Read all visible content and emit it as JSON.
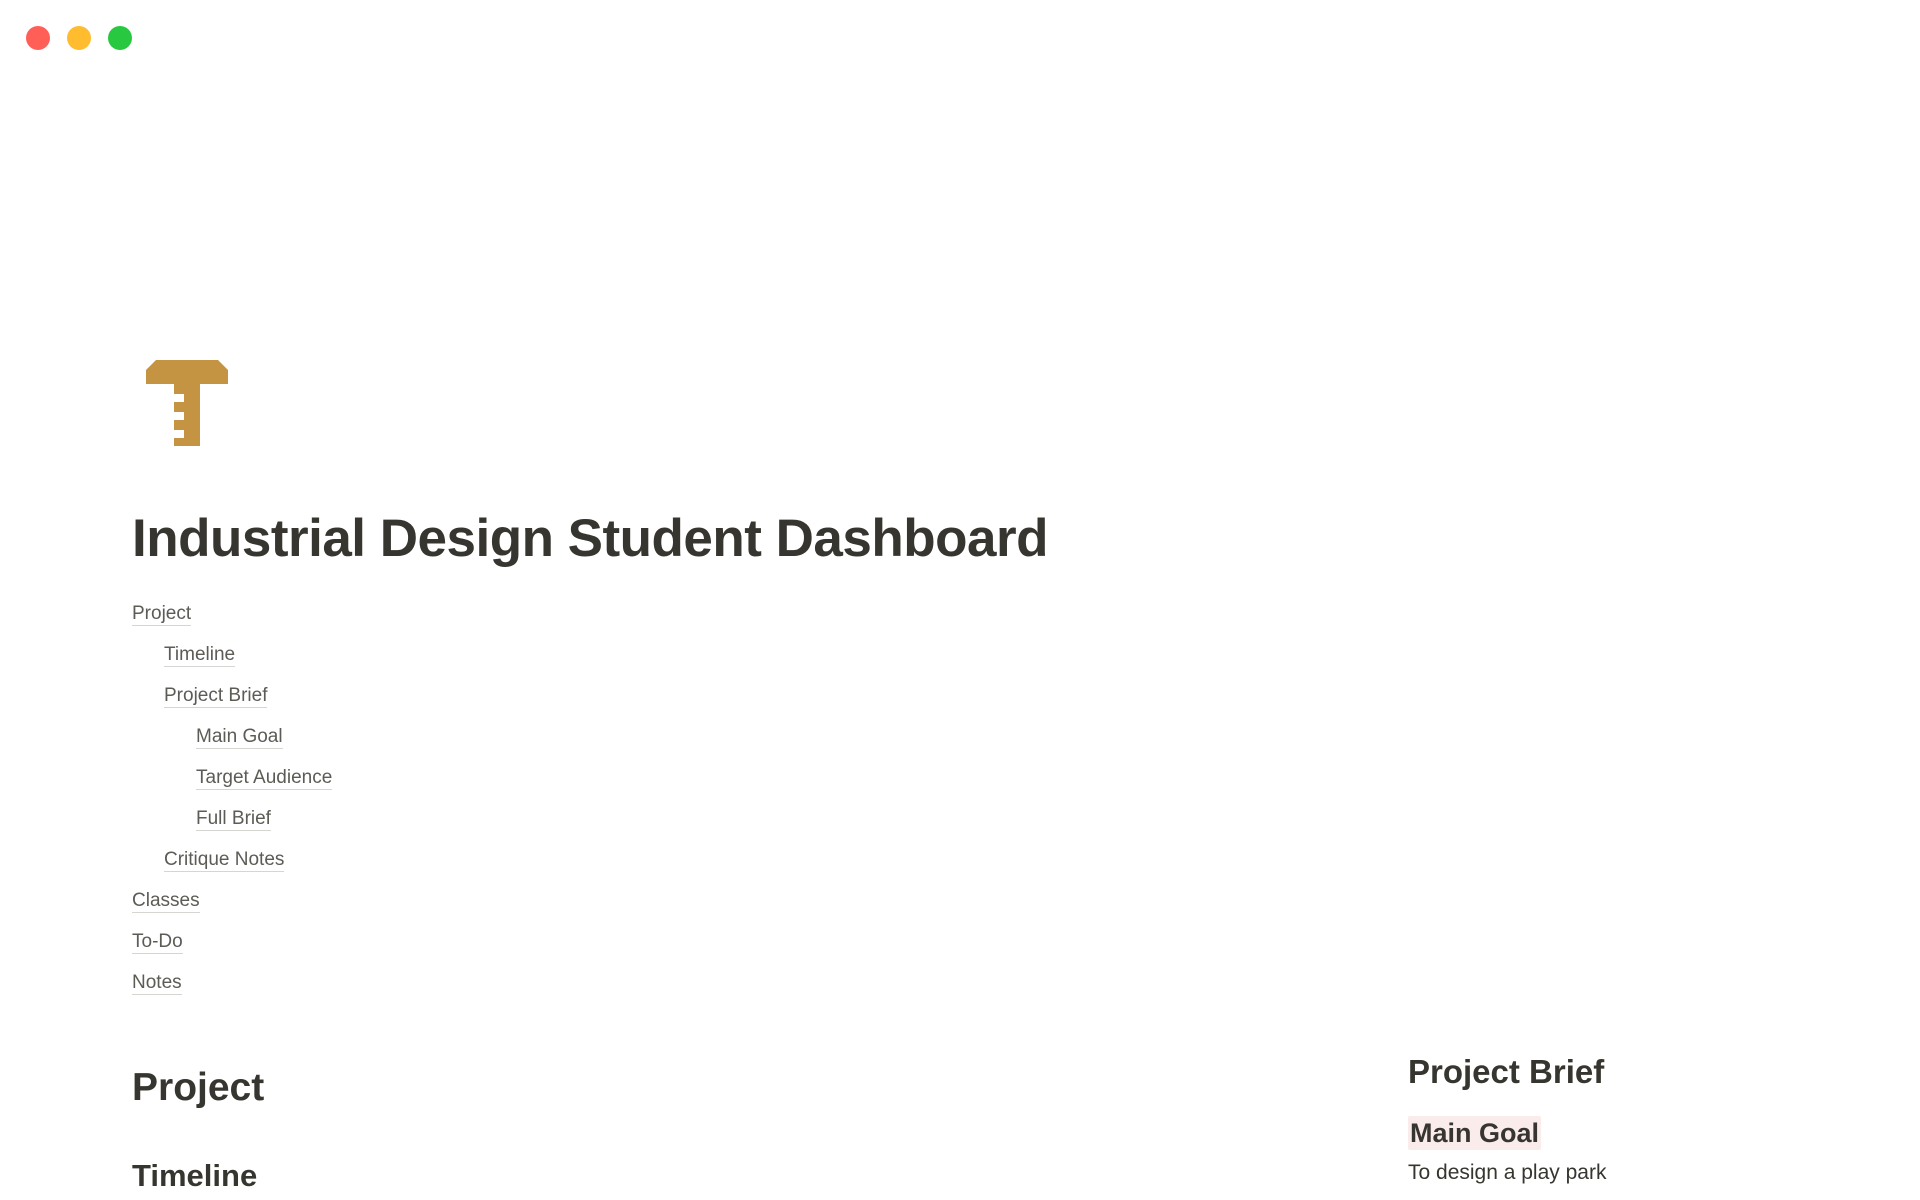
{
  "window": {
    "traffic_lights": {
      "close_color": "#ff5f57",
      "minimize_color": "#febc2e",
      "maximize_color": "#28c840"
    }
  },
  "page": {
    "icon": "ruler-tsquare-icon",
    "icon_color": "#c49443",
    "title": "Industrial Design Student Dashboard"
  },
  "toc": {
    "items": [
      {
        "label": "Project",
        "level": 0
      },
      {
        "label": "Timeline",
        "level": 1
      },
      {
        "label": "Project Brief",
        "level": 1
      },
      {
        "label": "Main Goal",
        "level": 2
      },
      {
        "label": "Target Audience",
        "level": 2
      },
      {
        "label": "Full Brief",
        "level": 2
      },
      {
        "label": "Critique Notes",
        "level": 1
      },
      {
        "label": "Classes",
        "level": 0
      },
      {
        "label": "To-Do",
        "level": 0
      },
      {
        "label": "Notes",
        "level": 0
      }
    ]
  },
  "sections": {
    "project_heading": "Project",
    "timeline_heading": "Timeline"
  },
  "brief": {
    "title": "Project Brief",
    "main_goal_heading": "Main Goal",
    "main_goal_text": "To design a play park"
  }
}
